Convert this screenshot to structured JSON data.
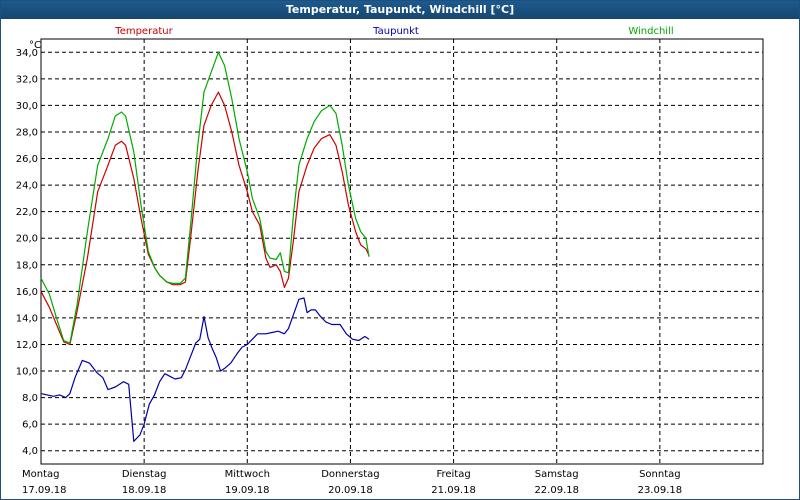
{
  "window": {
    "title": "Temperatur, Taupunkt, Windchill [°C]"
  },
  "colors": {
    "title_bar": "#16466f",
    "temperature": "#cc0000",
    "dewpoint": "#0000aa",
    "windchill": "#00aa00",
    "grid": "#000000"
  },
  "chart_data": {
    "type": "line",
    "title": "Temperatur, Taupunkt, Windchill [°C]",
    "ylabel": "°C",
    "ylim": [
      3,
      35
    ],
    "grid": true,
    "legend_placement": "top",
    "y_ticks": [
      "4,0",
      "6,0",
      "8,0",
      "10,0",
      "12,0",
      "14,0",
      "16,0",
      "18,0",
      "20,0",
      "22,0",
      "24,0",
      "26,0",
      "28,0",
      "30,0",
      "32,0",
      "34,0"
    ],
    "y_tick_values": [
      4,
      6,
      8,
      10,
      12,
      14,
      16,
      18,
      20,
      22,
      24,
      26,
      28,
      30,
      32,
      34
    ],
    "x_range_days": [
      0,
      7
    ],
    "x_ticks": [
      {
        "day": "Montag",
        "date": "17.09.18"
      },
      {
        "day": "Dienstag",
        "date": "18.09.18"
      },
      {
        "day": "Mittwoch",
        "date": "19.09.18"
      },
      {
        "day": "Donnerstag",
        "date": "20.09.18"
      },
      {
        "day": "Freitag",
        "date": "21.09.18"
      },
      {
        "day": "Samstag",
        "date": "22.09.18"
      },
      {
        "day": "Sonntag",
        "date": "23.09.18"
      }
    ],
    "series": [
      {
        "name": "Temperatur",
        "color": "#cc0000",
        "points": [
          [
            0.0,
            16.0
          ],
          [
            0.08,
            14.8
          ],
          [
            0.15,
            13.5
          ],
          [
            0.22,
            12.2
          ],
          [
            0.28,
            12.0
          ],
          [
            0.35,
            14.5
          ],
          [
            0.45,
            18.5
          ],
          [
            0.55,
            23.5
          ],
          [
            0.65,
            25.5
          ],
          [
            0.72,
            27.0
          ],
          [
            0.78,
            27.3
          ],
          [
            0.82,
            27.0
          ],
          [
            0.9,
            24.5
          ],
          [
            0.97,
            21.5
          ],
          [
            1.04,
            18.8
          ],
          [
            1.1,
            17.8
          ],
          [
            1.15,
            17.2
          ],
          [
            1.22,
            16.7
          ],
          [
            1.28,
            16.5
          ],
          [
            1.35,
            16.5
          ],
          [
            1.4,
            16.7
          ],
          [
            1.45,
            20.0
          ],
          [
            1.52,
            25.0
          ],
          [
            1.58,
            28.5
          ],
          [
            1.65,
            30.0
          ],
          [
            1.72,
            31.0
          ],
          [
            1.78,
            30.0
          ],
          [
            1.85,
            28.0
          ],
          [
            1.92,
            25.5
          ],
          [
            2.0,
            23.5
          ],
          [
            2.05,
            22.0
          ],
          [
            2.12,
            21.0
          ],
          [
            2.18,
            18.5
          ],
          [
            2.22,
            17.8
          ],
          [
            2.28,
            18.0
          ],
          [
            2.32,
            17.5
          ],
          [
            2.36,
            16.3
          ],
          [
            2.4,
            17.0
          ],
          [
            2.45,
            20.0
          ],
          [
            2.5,
            23.5
          ],
          [
            2.58,
            25.5
          ],
          [
            2.65,
            26.8
          ],
          [
            2.72,
            27.5
          ],
          [
            2.8,
            27.8
          ],
          [
            2.86,
            27.0
          ],
          [
            2.92,
            25.0
          ],
          [
            2.98,
            22.5
          ],
          [
            3.05,
            20.5
          ],
          [
            3.1,
            19.5
          ],
          [
            3.15,
            19.2
          ],
          [
            3.18,
            18.7
          ]
        ]
      },
      {
        "name": "Taupunkt",
        "color": "#0000aa",
        "points": [
          [
            0.0,
            8.3
          ],
          [
            0.06,
            8.2
          ],
          [
            0.12,
            8.1
          ],
          [
            0.18,
            8.2
          ],
          [
            0.24,
            8.0
          ],
          [
            0.28,
            8.3
          ],
          [
            0.33,
            9.5
          ],
          [
            0.4,
            10.8
          ],
          [
            0.47,
            10.6
          ],
          [
            0.54,
            9.9
          ],
          [
            0.6,
            9.5
          ],
          [
            0.65,
            8.6
          ],
          [
            0.72,
            8.8
          ],
          [
            0.8,
            9.2
          ],
          [
            0.85,
            9.0
          ],
          [
            0.9,
            4.7
          ],
          [
            0.96,
            5.2
          ],
          [
            1.0,
            6.0
          ],
          [
            1.05,
            7.5
          ],
          [
            1.1,
            8.2
          ],
          [
            1.15,
            9.2
          ],
          [
            1.2,
            9.8
          ],
          [
            1.25,
            9.6
          ],
          [
            1.3,
            9.4
          ],
          [
            1.36,
            9.5
          ],
          [
            1.4,
            10.1
          ],
          [
            1.46,
            11.3
          ],
          [
            1.5,
            12.1
          ],
          [
            1.54,
            12.4
          ],
          [
            1.58,
            14.1
          ],
          [
            1.62,
            12.5
          ],
          [
            1.66,
            11.7
          ],
          [
            1.7,
            11.0
          ],
          [
            1.74,
            10.0
          ],
          [
            1.78,
            10.2
          ],
          [
            1.84,
            10.6
          ],
          [
            1.9,
            11.3
          ],
          [
            1.95,
            11.8
          ],
          [
            2.0,
            12.0
          ],
          [
            2.05,
            12.4
          ],
          [
            2.1,
            12.8
          ],
          [
            2.18,
            12.8
          ],
          [
            2.24,
            12.9
          ],
          [
            2.3,
            13.0
          ],
          [
            2.36,
            12.8
          ],
          [
            2.4,
            13.2
          ],
          [
            2.45,
            14.3
          ],
          [
            2.5,
            15.4
          ],
          [
            2.55,
            15.5
          ],
          [
            2.58,
            14.4
          ],
          [
            2.62,
            14.6
          ],
          [
            2.66,
            14.6
          ],
          [
            2.7,
            14.2
          ],
          [
            2.76,
            13.7
          ],
          [
            2.82,
            13.5
          ],
          [
            2.9,
            13.5
          ],
          [
            2.96,
            12.8
          ],
          [
            3.02,
            12.4
          ],
          [
            3.08,
            12.3
          ],
          [
            3.14,
            12.6
          ],
          [
            3.18,
            12.4
          ]
        ]
      },
      {
        "name": "Windchill",
        "color": "#00aa00",
        "points": [
          [
            0.0,
            17.0
          ],
          [
            0.08,
            15.8
          ],
          [
            0.15,
            14.0
          ],
          [
            0.22,
            12.3
          ],
          [
            0.28,
            12.1
          ],
          [
            0.35,
            15.0
          ],
          [
            0.45,
            20.5
          ],
          [
            0.55,
            25.5
          ],
          [
            0.65,
            27.5
          ],
          [
            0.72,
            29.2
          ],
          [
            0.78,
            29.5
          ],
          [
            0.82,
            29.2
          ],
          [
            0.9,
            26.5
          ],
          [
            0.97,
            22.5
          ],
          [
            1.04,
            19.0
          ],
          [
            1.1,
            17.8
          ],
          [
            1.15,
            17.2
          ],
          [
            1.22,
            16.7
          ],
          [
            1.28,
            16.6
          ],
          [
            1.35,
            16.6
          ],
          [
            1.4,
            17.0
          ],
          [
            1.45,
            21.0
          ],
          [
            1.52,
            27.0
          ],
          [
            1.58,
            31.0
          ],
          [
            1.65,
            32.5
          ],
          [
            1.72,
            34.0
          ],
          [
            1.78,
            33.0
          ],
          [
            1.85,
            30.5
          ],
          [
            1.92,
            27.5
          ],
          [
            2.0,
            25.0
          ],
          [
            2.05,
            23.0
          ],
          [
            2.12,
            21.5
          ],
          [
            2.18,
            19.0
          ],
          [
            2.22,
            18.5
          ],
          [
            2.28,
            18.4
          ],
          [
            2.32,
            18.9
          ],
          [
            2.36,
            17.5
          ],
          [
            2.4,
            17.4
          ],
          [
            2.45,
            22.0
          ],
          [
            2.5,
            25.5
          ],
          [
            2.58,
            27.5
          ],
          [
            2.65,
            28.8
          ],
          [
            2.72,
            29.6
          ],
          [
            2.8,
            30.0
          ],
          [
            2.86,
            29.4
          ],
          [
            2.92,
            27.0
          ],
          [
            2.98,
            24.0
          ],
          [
            3.05,
            21.5
          ],
          [
            3.1,
            20.5
          ],
          [
            3.15,
            20.0
          ],
          [
            3.18,
            18.6
          ]
        ]
      }
    ]
  }
}
